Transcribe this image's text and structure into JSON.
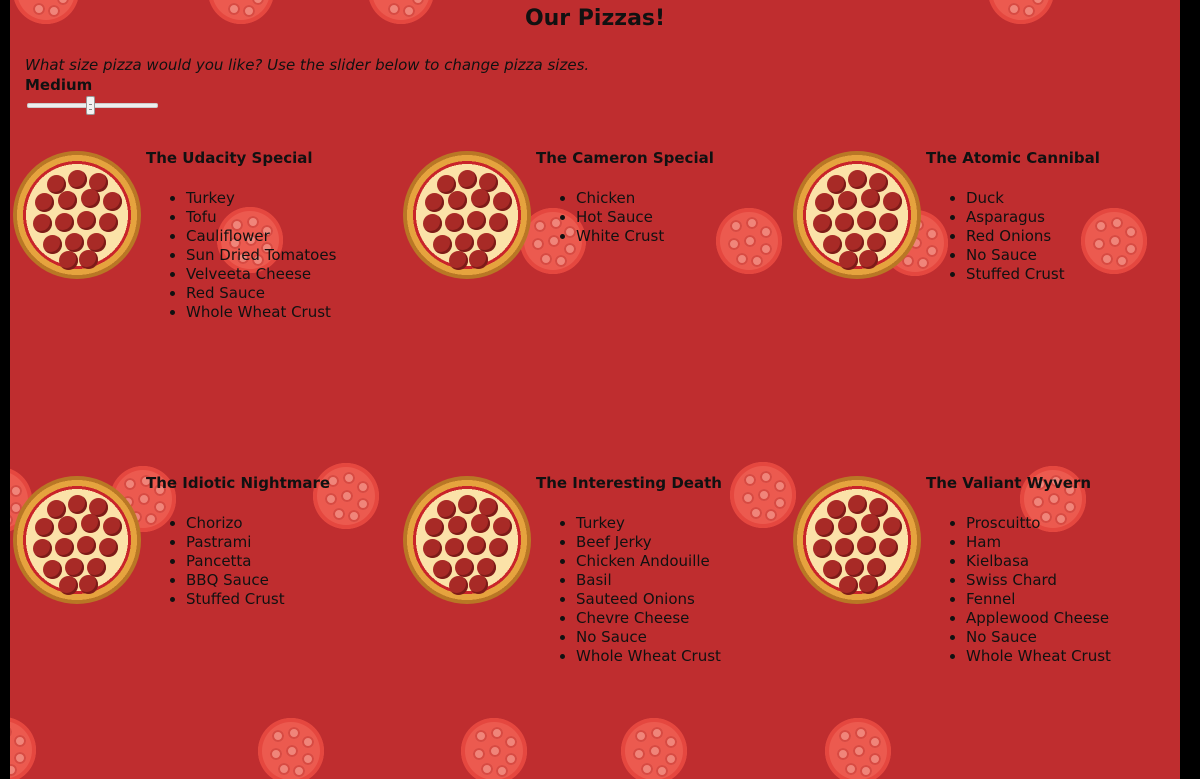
{
  "page": {
    "title": "Our Pizzas!",
    "prompt": "What size pizza would you like? Use the slider below to change pizza sizes.",
    "size_label": "Medium",
    "slider": {
      "current_size": "Medium"
    }
  },
  "pizzas": [
    {
      "name": "The Udacity Special",
      "ingredients": [
        "Turkey",
        "Tofu",
        "Cauliflower",
        "Sun Dried Tomatoes",
        "Velveeta Cheese",
        "Red Sauce",
        "Whole Wheat Crust"
      ]
    },
    {
      "name": "The Cameron Special",
      "ingredients": [
        "Chicken",
        "Hot Sauce",
        "White Crust"
      ]
    },
    {
      "name": "The Atomic Cannibal",
      "ingredients": [
        "Duck",
        "Asparagus",
        "Red Onions",
        "No Sauce",
        "Stuffed Crust"
      ]
    },
    {
      "name": "The Idiotic Nightmare",
      "ingredients": [
        "Chorizo",
        "Pastrami",
        "Pancetta",
        "BBQ Sauce",
        "Stuffed Crust"
      ]
    },
    {
      "name": "The Interesting Death",
      "ingredients": [
        "Turkey",
        "Beef Jerky",
        "Chicken Andouille",
        "Basil",
        "Sauteed Onions",
        "Chevre Cheese",
        "No Sauce",
        "Whole Wheat Crust"
      ]
    },
    {
      "name": "The Valiant Wyvern",
      "ingredients": [
        "Proscuitto",
        "Ham",
        "Kielbasa",
        "Swiss Chard",
        "Fennel",
        "Applewood Cheese",
        "No Sauce",
        "Whole Wheat Crust"
      ]
    }
  ],
  "colors": {
    "background": "#bf2d2f",
    "frame": "#000000",
    "text": "#111111"
  }
}
